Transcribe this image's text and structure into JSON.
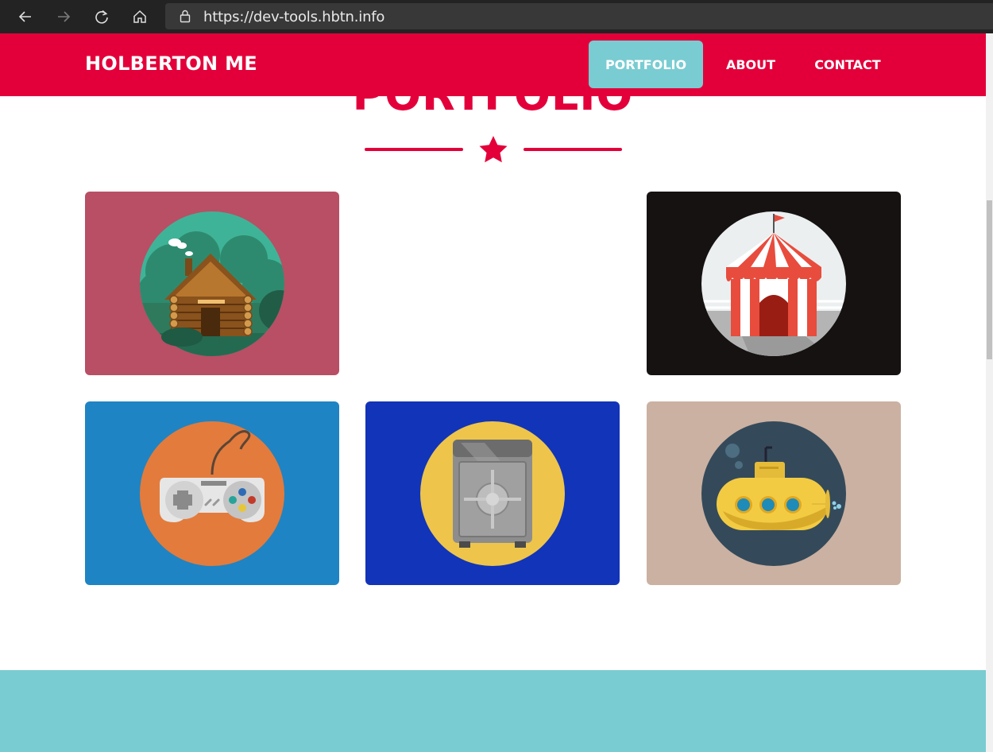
{
  "browser": {
    "url_scheme": "https://",
    "url_host": "dev-tools.hbtn.info"
  },
  "header": {
    "brand": "HOLBERTON ME",
    "nav": [
      {
        "label": "PORTFOLIO",
        "active": true
      },
      {
        "label": "ABOUT",
        "active": false
      },
      {
        "label": "CONTACT",
        "active": false
      }
    ]
  },
  "portfolio": {
    "title": "PORTFOLIO",
    "items": [
      {
        "name": "cabin",
        "icon": "log-cabin-icon",
        "bg": "#b84f64"
      },
      {
        "name": "circus",
        "icon": "circus-tent-icon",
        "bg": "#151211"
      },
      {
        "name": "game",
        "icon": "game-controller-icon",
        "bg": "#1f84c3"
      },
      {
        "name": "safe",
        "icon": "safe-icon",
        "bg": "#1234b8"
      },
      {
        "name": "submarine",
        "icon": "submarine-icon",
        "bg": "#cbb1a2"
      }
    ]
  },
  "colors": {
    "primary": "#e3003a",
    "accent": "#79ccd2"
  }
}
